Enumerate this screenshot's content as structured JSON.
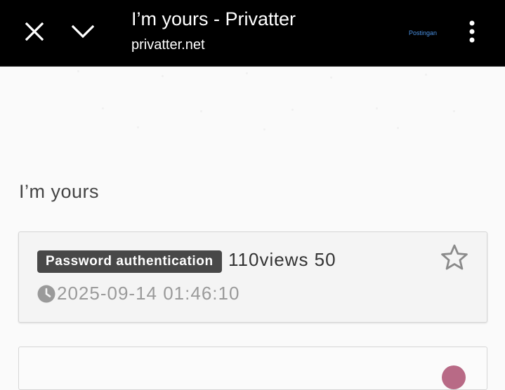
{
  "topbar": {
    "title": "I’m yours - Privatter",
    "url": "privatter.net",
    "ext_label": "Postingan",
    "icons": [
      "close-icon",
      "chevron-down-icon",
      "more-vertical-icon"
    ]
  },
  "page": {
    "heading": "I’m yours"
  },
  "post": {
    "badge": "Password authentication",
    "views": "110views 50",
    "date": "2025-09-14 01:46:10",
    "icons": [
      "clock-icon",
      "star-outline-icon"
    ]
  },
  "next_post": {
    "icons": [
      "avatar"
    ]
  },
  "colors": {
    "topbar_bg": "#000000",
    "badge_bg": "#484848",
    "ext_label": "#4a90e2",
    "avatar": "#b86a86"
  }
}
